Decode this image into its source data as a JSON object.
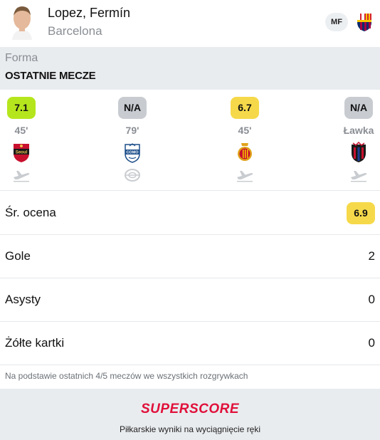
{
  "player": {
    "name": "Lopez, Fermín",
    "club": "Barcelona",
    "position": "MF"
  },
  "section": {
    "subtitle": "Forma",
    "title": "OSTATNIE MECZE"
  },
  "matches": [
    {
      "rating": "7.1",
      "rating_color": "#b5e61d",
      "minutes": "45'",
      "opponent_icon": "fc-seoul-crest-icon",
      "venue_icon": "airplane-away-icon"
    },
    {
      "rating": "N/A",
      "rating_color": "#c8ccd1",
      "minutes": "79'",
      "opponent_icon": "como-crest-icon",
      "venue_icon": "stadium-home-icon"
    },
    {
      "rating": "6.7",
      "rating_color": "#f6d94a",
      "minutes": "45'",
      "opponent_icon": "mallorca-crest-icon",
      "venue_icon": "airplane-away-icon"
    },
    {
      "rating": "N/A",
      "rating_color": "#c8ccd1",
      "minutes": "Ławka",
      "opponent_icon": "levante-crest-icon",
      "venue_icon": "airplane-away-icon"
    }
  ],
  "stats": {
    "avg_rating": {
      "label": "Śr. ocena",
      "value": "6.9"
    },
    "goals": {
      "label": "Gole",
      "value": "2"
    },
    "assists": {
      "label": "Asysty",
      "value": "0"
    },
    "yellow_cards": {
      "label": "Żółte kartki",
      "value": "0"
    }
  },
  "footnote": "Na podstawie ostatnich 4/5 meczów we wszystkich rozgrywkach",
  "footer": {
    "brand": "SUPERSCORE",
    "tagline": "Piłkarskie wyniki na wyciągnięcie ręki"
  },
  "colors": {
    "accent_yellow": "#f6d94a",
    "accent_green": "#b5e61d",
    "neutral_badge": "#c8ccd1",
    "brand_red": "#e0103a",
    "section_bg": "#e9ecef"
  }
}
